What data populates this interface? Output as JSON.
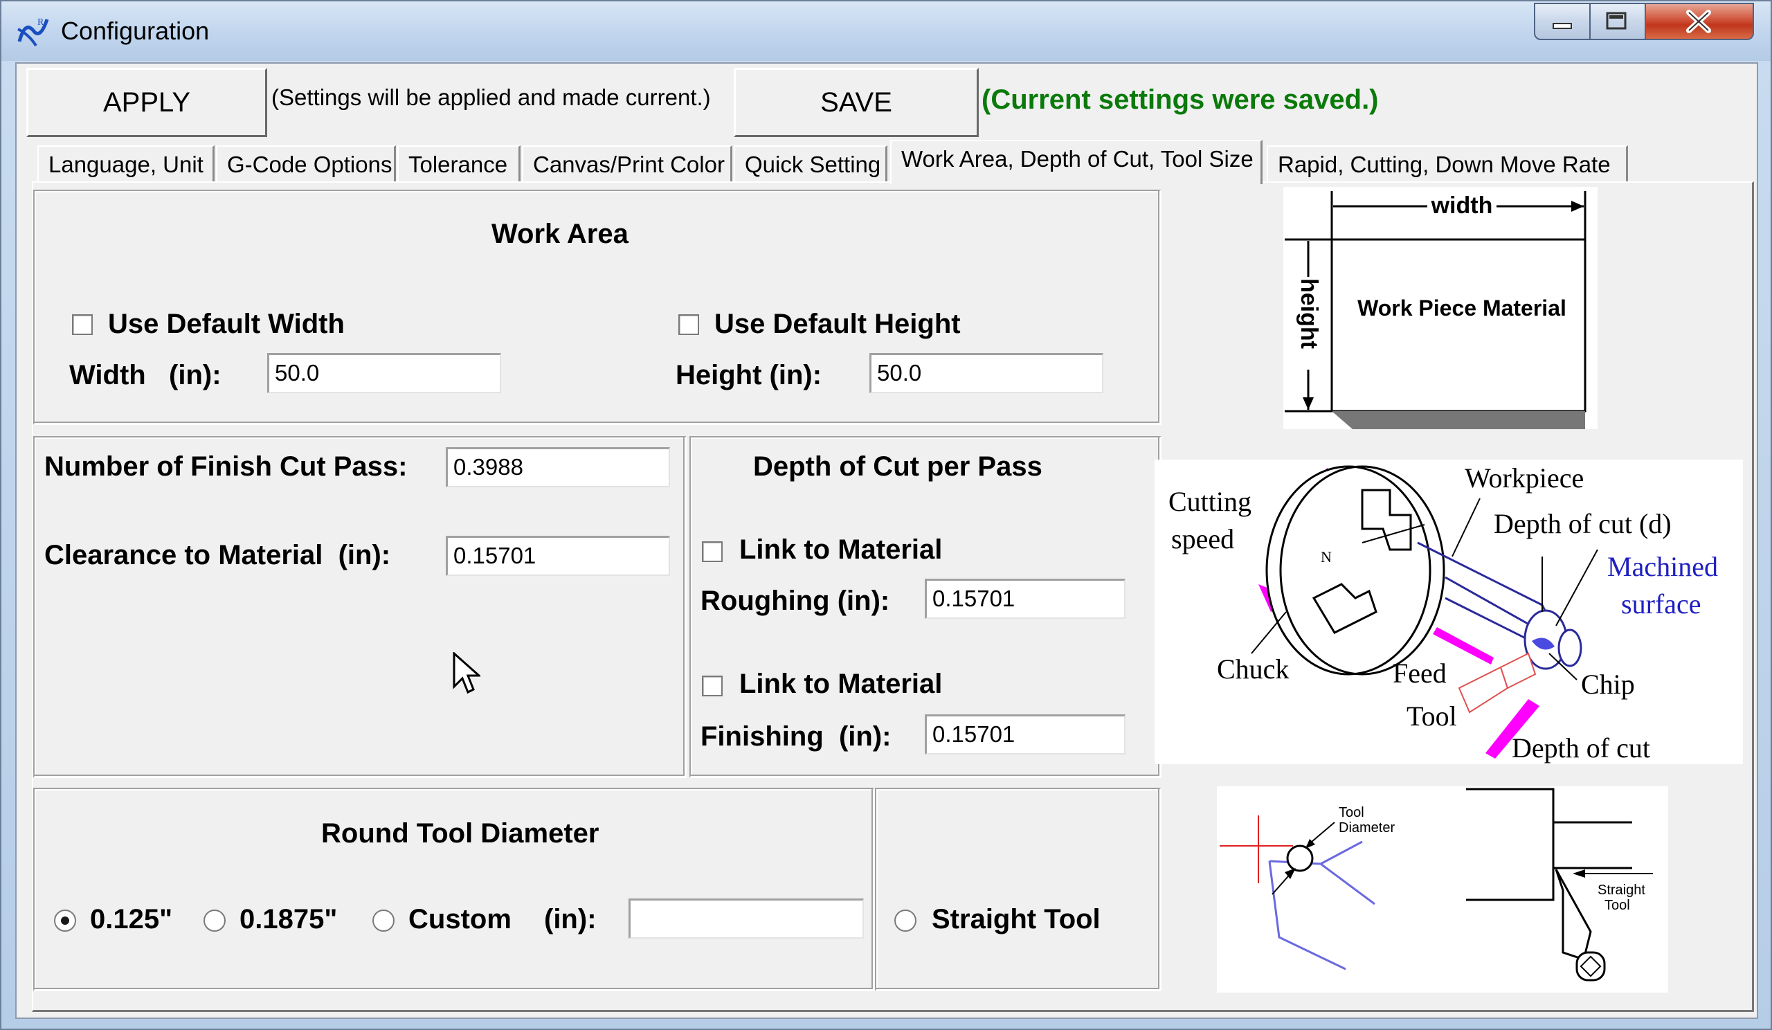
{
  "window": {
    "title": "Configuration",
    "min_icon": "minimize-icon",
    "max_icon": "maximize-icon",
    "close_icon": "close-icon"
  },
  "toolbar": {
    "apply_label": "APPLY",
    "apply_note": "(Settings will be applied and made current.)",
    "save_label": "SAVE",
    "save_status": "(Current settings were saved.)",
    "save_status_color": "#0a7a0a"
  },
  "tabs": [
    {
      "label": "Language, Unit",
      "active": false
    },
    {
      "label": "G-Code Options",
      "active": false
    },
    {
      "label": "Tolerance",
      "active": false
    },
    {
      "label": "Canvas/Print Color",
      "active": false
    },
    {
      "label": "Quick Setting",
      "active": false
    },
    {
      "label": "Work Area, Depth of Cut, Tool Size",
      "active": true
    },
    {
      "label": "Rapid, Cutting, Down Move Rate",
      "active": false
    }
  ],
  "work_area": {
    "title": "Work Area",
    "use_default_width": {
      "label": "Use Default Width",
      "checked": false
    },
    "use_default_height": {
      "label": "Use Default Height",
      "checked": false
    },
    "width_label": "Width   (in):",
    "width_value": "50.0",
    "height_label": "Height (in):",
    "height_value": "50.0"
  },
  "finish": {
    "passes_label": "Number of Finish Cut Pass:",
    "passes_value": "0.3988",
    "clearance_label": "Clearance to Material  (in):",
    "clearance_value": "0.15701"
  },
  "depth": {
    "title": "Depth of Cut per Pass",
    "link1": {
      "label": "Link to Material",
      "checked": false
    },
    "roughing_label": "Roughing (in):",
    "roughing_value": "0.15701",
    "link2": {
      "label": "Link to Material",
      "checked": false
    },
    "finishing_label": "Finishing  (in):",
    "finishing_value": "0.15701"
  },
  "tool": {
    "title": "Round Tool Diameter",
    "options": [
      {
        "label": "0.125\"",
        "selected": true
      },
      {
        "label": "0.1875\"",
        "selected": false
      },
      {
        "label": "Custom",
        "selected": false
      }
    ],
    "custom_unit_label": "(in):",
    "custom_value": "",
    "straight_label": "Straight Tool",
    "straight_selected": false
  },
  "diagram_work_piece": {
    "width_label": "width",
    "height_label": "height",
    "body_label": "Work Piece Material"
  },
  "diagram_lathe": {
    "labels": {
      "cutting": "Cutting",
      "speed": "speed",
      "workpiece": "Workpiece",
      "depth_d": "Depth of cut (d)",
      "machined": "Machined",
      "surface": "surface",
      "chuck": "Chuck",
      "feed": "Feed",
      "chip": "Chip",
      "tool": "Tool",
      "depth": "Depth of cut"
    },
    "accent_color": "#ff00ff",
    "machined_color": "#2020c0"
  },
  "diagram_tool": {
    "tool_diameter_1": "Tool",
    "tool_diameter_2": "Diameter",
    "straight_1": "Straight",
    "straight_2": "Tool"
  }
}
